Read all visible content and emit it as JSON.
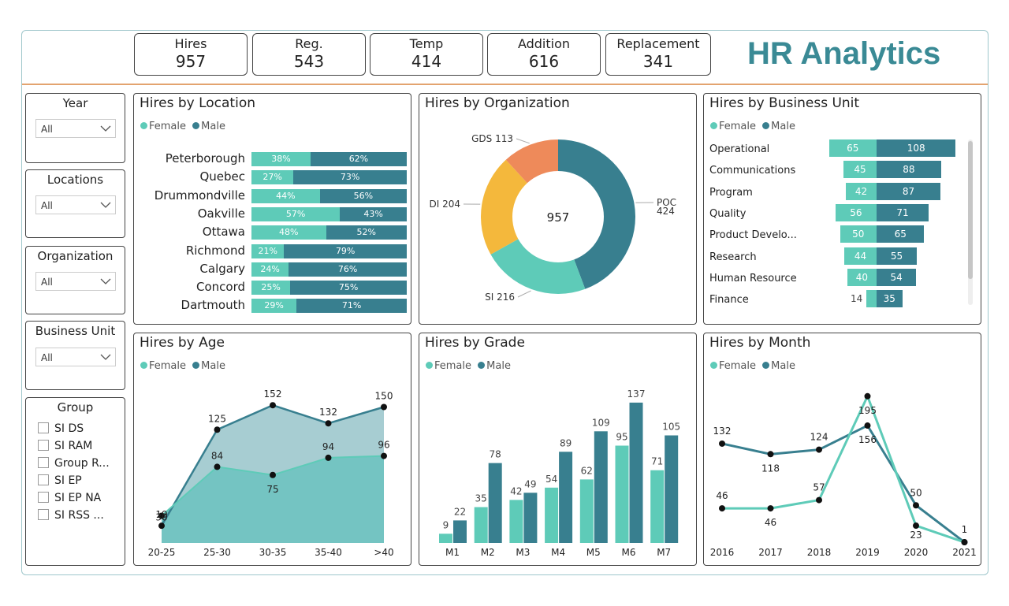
{
  "title": "HR Analytics",
  "colors": {
    "female": "#5ecbb8",
    "male": "#387f8f",
    "accent": "#3a8a95",
    "orange": "#ee8a5a",
    "yellow": "#f4b83c"
  },
  "kpis": [
    {
      "label": "Hires",
      "value": "957"
    },
    {
      "label": "Reg.",
      "value": "543"
    },
    {
      "label": "Temp",
      "value": "414"
    },
    {
      "label": "Addition",
      "value": "616"
    },
    {
      "label": "Replacement",
      "value": "341"
    }
  ],
  "slicers": [
    {
      "title": "Year",
      "value": "All"
    },
    {
      "title": "Locations",
      "value": "All"
    },
    {
      "title": "Organization",
      "value": "All"
    },
    {
      "title": "Business Unit",
      "value": "All"
    }
  ],
  "group": {
    "title": "Group",
    "items": [
      "SI DS",
      "SI RAM",
      "Group R...",
      "SI EP",
      "SI EP NA",
      "SI RSS ..."
    ]
  },
  "legend": {
    "female": "Female",
    "male": "Male"
  },
  "panels": {
    "location": "Hires by Location",
    "organization": "Hires by Organization",
    "business_unit": "Hires by Business Unit",
    "age": "Hires by Age",
    "grade": "Hires by Grade",
    "month": "Hires by Month"
  },
  "chart_data": [
    {
      "type": "bar",
      "title": "Hires by Location",
      "stacked": "100%",
      "categories": [
        "Peterborough",
        "Quebec",
        "Drummondville",
        "Oakville",
        "Ottawa",
        "Richmond",
        "Calgary",
        "Concord",
        "Dartmouth"
      ],
      "series": [
        {
          "name": "Female",
          "values": [
            38,
            27,
            44,
            57,
            48,
            21,
            24,
            25,
            29
          ],
          "labels": [
            "38%",
            "27%",
            "44%",
            "57%",
            "48%",
            "21%",
            "24%",
            "25%",
            "29%"
          ]
        },
        {
          "name": "Male",
          "values": [
            62,
            73,
            56,
            43,
            52,
            79,
            76,
            75,
            71
          ],
          "labels": [
            "62%",
            "73%",
            "56%",
            "43%",
            "52%",
            "79%",
            "76%",
            "75%",
            "71%"
          ]
        }
      ]
    },
    {
      "type": "pie",
      "title": "Hires by Organization",
      "center_label": "957",
      "slices": [
        {
          "name": "POC",
          "value": 424,
          "label_name": "POC",
          "label_value": "424"
        },
        {
          "name": "SI",
          "value": 216,
          "label": "SI 216"
        },
        {
          "name": "DI",
          "value": 204,
          "label": "DI 204"
        },
        {
          "name": "GDS",
          "value": 113,
          "label": "GDS 113"
        }
      ]
    },
    {
      "type": "bar",
      "title": "Hires by Business Unit",
      "categories": [
        "Operational",
        "Communications",
        "Program",
        "Quality",
        "Product Develo...",
        "Research",
        "Human Resource",
        "Finance"
      ],
      "series": [
        {
          "name": "Female",
          "values": [
            65,
            45,
            42,
            56,
            50,
            44,
            40,
            14
          ],
          "labels": [
            "65",
            "45",
            "42",
            "56",
            "50",
            "44",
            "40",
            "14"
          ]
        },
        {
          "name": "Male",
          "values": [
            108,
            88,
            87,
            71,
            65,
            55,
            54,
            35
          ],
          "labels": [
            "108",
            "88",
            "87",
            "71",
            "65",
            "55",
            "54",
            "35"
          ]
        }
      ]
    },
    {
      "type": "area",
      "title": "Hires by Age",
      "categories": [
        "20-25",
        "25-30",
        "30-35",
        "35-40",
        ">40"
      ],
      "series": [
        {
          "name": "Male",
          "values": [
            19,
            125,
            152,
            132,
            150
          ],
          "labels": [
            "19",
            "125",
            "152",
            "132",
            "150"
          ]
        },
        {
          "name": "Female",
          "values": [
            30,
            84,
            75,
            94,
            96
          ],
          "labels": [
            "30",
            "84",
            "75",
            "94",
            "96"
          ]
        }
      ],
      "ylim": [
        0,
        160
      ]
    },
    {
      "type": "bar",
      "title": "Hires by Grade",
      "categories": [
        "M1",
        "M2",
        "M3",
        "M4",
        "M5",
        "M6",
        "M7"
      ],
      "series": [
        {
          "name": "Female",
          "values": [
            9,
            35,
            42,
            54,
            62,
            95,
            71
          ],
          "labels": [
            "9",
            "35",
            "42",
            "54",
            "62",
            "95",
            "71"
          ]
        },
        {
          "name": "Male",
          "values": [
            22,
            78,
            49,
            89,
            109,
            137,
            105
          ],
          "labels": [
            "22",
            "78",
            "49",
            "89",
            "109",
            "137",
            "105"
          ]
        }
      ],
      "ylim": [
        0,
        140
      ]
    },
    {
      "type": "line",
      "title": "Hires by Month",
      "categories": [
        "2016",
        "2017",
        "2018",
        "2019",
        "2020",
        "2021"
      ],
      "series": [
        {
          "name": "Female",
          "values": [
            46,
            46,
            57,
            195,
            23,
            1
          ],
          "labels": [
            "46",
            "46",
            "57",
            "195",
            "23",
            "1"
          ]
        },
        {
          "name": "Male",
          "values": [
            132,
            118,
            124,
            156,
            50,
            1
          ],
          "labels": [
            "132",
            "118",
            "124",
            "156",
            "50",
            ""
          ]
        }
      ],
      "ylim": [
        0,
        200
      ]
    }
  ]
}
